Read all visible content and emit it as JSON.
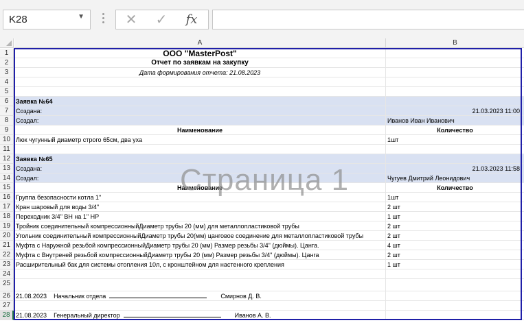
{
  "formula_bar": {
    "name_box": "K28",
    "cancel_icon": "✕",
    "enter_icon": "✓",
    "fx_label": "fx",
    "formula": ""
  },
  "columns": [
    "A",
    "B"
  ],
  "rows": {
    "r1": {
      "num": "1",
      "a": "ООО \"MasterPost\"",
      "b": ""
    },
    "r2": {
      "num": "2",
      "a": "Отчет по заявкам на закупку",
      "b": ""
    },
    "r3": {
      "num": "3",
      "a": "Дата формирования отчета: 21.08.2023",
      "b": ""
    },
    "r4": {
      "num": "4",
      "a": "",
      "b": ""
    },
    "r5": {
      "num": "5",
      "a": "",
      "b": ""
    },
    "r6": {
      "num": "6",
      "a": "Заявка №64",
      "b": ""
    },
    "r7": {
      "num": "7",
      "a": "Создана:",
      "b": "21.03.2023 11:00"
    },
    "r8": {
      "num": "8",
      "a": "Создал:",
      "b": "Иванов Иван Иванович"
    },
    "r9": {
      "num": "9",
      "a": "Наименование",
      "b": "Количество"
    },
    "r10": {
      "num": "10",
      "a": "Люк чугунный диаметр строго 65см, два уха",
      "b": "1шт"
    },
    "r11": {
      "num": "11",
      "a": "",
      "b": ""
    },
    "r12": {
      "num": "12",
      "a": "Заявка №65",
      "b": ""
    },
    "r13": {
      "num": "13",
      "a": "Создана:",
      "b": "21.03.2023 11:58"
    },
    "r14": {
      "num": "14",
      "a": "Создал:",
      "b": "Чугуев Дмитрий Леонидович"
    },
    "r15": {
      "num": "15",
      "a": "Наименование",
      "b": "Количество"
    },
    "r16": {
      "num": "16",
      "a": "Группа безопасности котла 1\"",
      "b": "1шт"
    },
    "r17": {
      "num": "17",
      "a": "Кран шаровый для воды 3/4\"",
      "b": "2 шт"
    },
    "r18": {
      "num": "18",
      "a": "Переходник 3/4\" ВН на 1\" НР",
      "b": "1 шт"
    },
    "r19": {
      "num": "19",
      "a": "Тройник соединительный компрессионныйДиаметр трубы 20 (мм) для металлопластиковой трубы",
      "b": "2 шт"
    },
    "r20": {
      "num": "20",
      "a": "Угольник соединительный компрессионныйДиаметр трубы 20(мм) цанговое соединение для металлопластиковой трубы",
      "b": "2 шт"
    },
    "r21": {
      "num": "21",
      "a": "Муфта с Наружной резьбой компрессионныйДиаметр трубы 20 (мм) Размер резьбы 3/4\" (дюймы).  Цанга.",
      "b": "4 шт"
    },
    "r22": {
      "num": "22",
      "a": "Муфта с Внутреней резьбой компрессионныйДиаметр трубы 20 (мм) Размер резьбы 3/4\" (дюймы).  Цанга",
      "b": "2 шт"
    },
    "r23": {
      "num": "23",
      "a": "Расширительный бак для системы отопления 10л, с кронштейном для настенного крепления",
      "b": "1 шт"
    },
    "r24": {
      "num": "24",
      "a": "",
      "b": ""
    },
    "r25": {
      "num": "25",
      "a": "",
      "b": ""
    },
    "r27": {
      "num": "27",
      "a": "",
      "b": ""
    }
  },
  "signatures": {
    "r26": {
      "num": "26",
      "date": "21.08.2023",
      "role": "Начальник отдела",
      "name": "Смирнов Д. В."
    },
    "r28": {
      "num": "28",
      "date": "21.08.2023",
      "role": "Генеральный директор",
      "name": "Иванов А. В."
    }
  },
  "watermark": "Страница 1",
  "colors": {
    "section_fill": "#d9e1f2",
    "print_area_border": "#1f1fa8",
    "selected_row_accent": "#217346"
  }
}
